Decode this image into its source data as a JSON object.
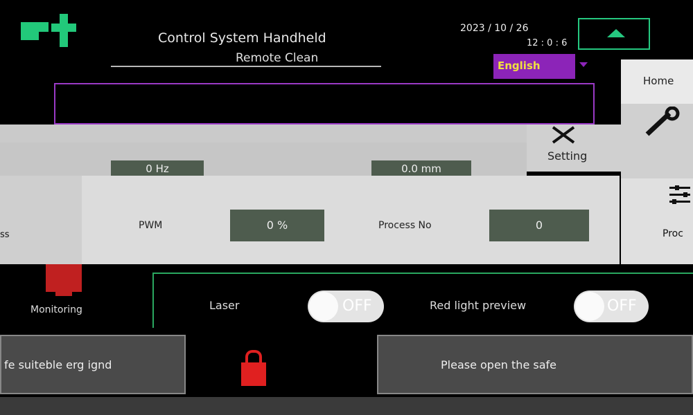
{
  "header": {
    "title": "Control System Handheld",
    "subtitle": "Remote Clean",
    "date": "2023 / 10 / 26",
    "time": "12 : 0 : 6",
    "language": "English",
    "brand_colors": {
      "logo": "#22c87a",
      "language_bg": "#8c24b8",
      "value_box": "#4e5c4e"
    }
  },
  "nav": {
    "home_label": "Home",
    "process_label": "Proc"
  },
  "params": {
    "setting_label": "Setting",
    "pwm_label": "PWM",
    "pwm_value": "0 %",
    "process_no_label": "Process No",
    "process_no_value": "0",
    "laser_freq_value": "0 Hz",
    "clean_width_value": "0.0 mm"
  },
  "controls": {
    "monitoring_label": "Monitoring",
    "laser_label": "Laser",
    "laser_state": "OFF",
    "red_light_label": "Red light preview",
    "red_light_state": "OFF"
  },
  "messages": {
    "left": "fe suiteble erg ignd",
    "right": "Please open the safe"
  },
  "icons": [
    "logo-icon",
    "up-arrow-icon",
    "dropdown-caret-icon",
    "tools-icon",
    "process-sliders-icon",
    "monitor-icon",
    "lock-icon"
  ]
}
